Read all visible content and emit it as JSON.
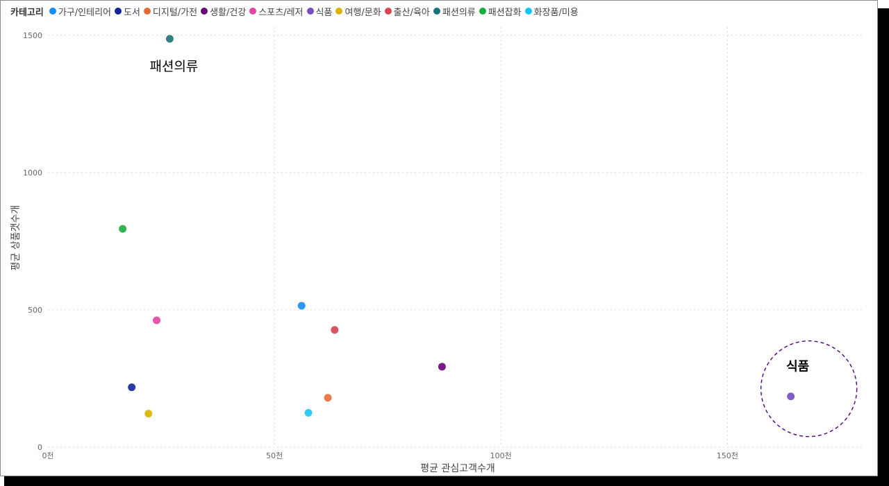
{
  "legend": {
    "title": "카테고리",
    "items": [
      {
        "label": "가구/인테리어",
        "color": "#118DFF"
      },
      {
        "label": "도서",
        "color": "#12239E"
      },
      {
        "label": "디지털/가전",
        "color": "#E66C37"
      },
      {
        "label": "생활/건강",
        "color": "#6B007B"
      },
      {
        "label": "스포츠/레저",
        "color": "#E044A7"
      },
      {
        "label": "식품",
        "color": "#744EC2"
      },
      {
        "label": "여행/문화",
        "color": "#D9B300"
      },
      {
        "label": "출산/육아",
        "color": "#D64550"
      },
      {
        "label": "패션의류",
        "color": "#197278"
      },
      {
        "label": "패션잡화",
        "color": "#1AAB40"
      },
      {
        "label": "화장품/미용",
        "color": "#15C6F4"
      }
    ]
  },
  "chart_data": {
    "type": "scatter",
    "xlabel": "평균 관심고객수개",
    "ylabel": "평균 상품갯수개",
    "xlim": [
      0,
      180000
    ],
    "ylim": [
      0,
      1550
    ],
    "x_ticks": [
      {
        "value": 0,
        "label": "0천"
      },
      {
        "value": 50000,
        "label": "50천"
      },
      {
        "value": 100000,
        "label": "100천"
      },
      {
        "value": 150000,
        "label": "150천"
      }
    ],
    "y_ticks": [
      {
        "value": 0,
        "label": "0"
      },
      {
        "value": 500,
        "label": "500"
      },
      {
        "value": 1000,
        "label": "1000"
      },
      {
        "value": 1500,
        "label": "1500"
      }
    ],
    "grid": true,
    "legend_position": "top-left",
    "points": [
      {
        "category": "가구/인테리어",
        "x": 56000,
        "y": 515
      },
      {
        "category": "도서",
        "x": 18500,
        "y": 218
      },
      {
        "category": "디지털/가전",
        "x": 61800,
        "y": 180
      },
      {
        "category": "생활/건강",
        "x": 87000,
        "y": 293
      },
      {
        "category": "스포츠/레저",
        "x": 24000,
        "y": 462
      },
      {
        "category": "식품",
        "x": 164000,
        "y": 185
      },
      {
        "category": "여행/문화",
        "x": 22200,
        "y": 122
      },
      {
        "category": "출산/육아",
        "x": 63300,
        "y": 427
      },
      {
        "category": "패션의류",
        "x": 26900,
        "y": 1487
      },
      {
        "category": "패션잡화",
        "x": 16500,
        "y": 795
      },
      {
        "category": "화장품/미용",
        "x": 57500,
        "y": 125
      }
    ],
    "annotations": [
      {
        "text": "패션의류",
        "target": "패션의류",
        "style": "label"
      },
      {
        "text": "식품",
        "target": "식품",
        "style": "dashed-circle",
        "circle_color": "#4B0082"
      }
    ]
  }
}
